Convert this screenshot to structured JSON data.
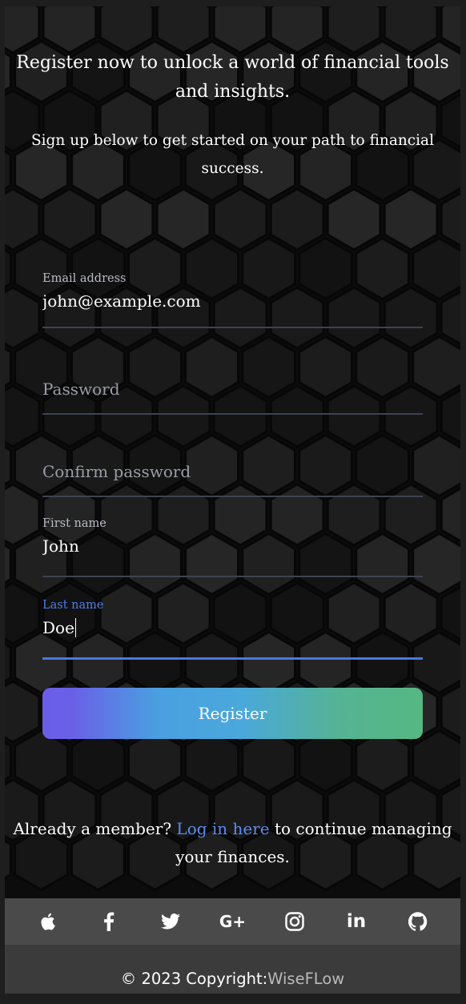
{
  "hero": {
    "headline": "Register now to unlock a world of financial tools and insights.",
    "subline": "Sign up below to get started on your path to financial success."
  },
  "form": {
    "email": {
      "label": "Email address",
      "value": "john@example.com"
    },
    "password": {
      "placeholder": "Password"
    },
    "confirm_password": {
      "placeholder": "Confirm password"
    },
    "first_name": {
      "label": "First name",
      "value": "John"
    },
    "last_name": {
      "label": "Last name",
      "value": "Doe"
    },
    "submit_label": "Register"
  },
  "login_prompt": {
    "before": "Already a member? ",
    "link": "Log in here",
    "after": " to continue managing your finances."
  },
  "social": {
    "icons": [
      "apple-icon",
      "facebook-icon",
      "twitter-icon",
      "google-plus-icon",
      "instagram-icon",
      "linkedin-icon",
      "github-icon"
    ],
    "google_plus_text": "G+",
    "linkedin_text": "in"
  },
  "footer": {
    "copyright": "© 2023 Copyright: ",
    "brand": "WiseFLow"
  },
  "colors": {
    "accent": "#4a78e0",
    "link": "#5b8cf0",
    "gradient_start": "#6a5ee8",
    "gradient_end": "#55b882"
  }
}
